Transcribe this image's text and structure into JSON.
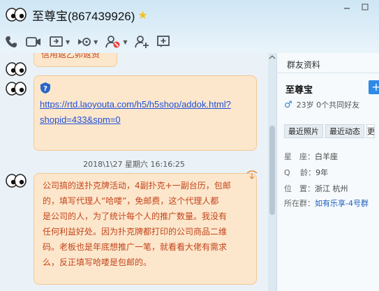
{
  "window": {
    "title": "至尊宝(867439926)"
  },
  "toolbar": {
    "items": [
      {
        "icon": "phone-icon"
      },
      {
        "icon": "video-camera-icon"
      },
      {
        "icon": "screen-share-icon"
      },
      {
        "icon": "remote-assist-icon"
      },
      {
        "icon": "block-user-icon"
      },
      {
        "icon": "add-user-icon"
      },
      {
        "icon": "new-window-icon"
      }
    ]
  },
  "chat": {
    "top_bubble_text": "信用返乙卯返资",
    "link_line1": "https://rtd.laoyouta.com/h5/h5shop/addok.html?",
    "link_line2": "shopid=433&spm=0",
    "timestamp": "2018\\1\\27 星期六 16:16:25",
    "message_lines": [
      "公司搞的送扑克牌活动，4副扑克+一副台历，包邮",
      "的，填写代理人“哈喽”，免邮费，这个代理人都",
      "是公司的人，为了统计每个人的推广数量。我没有",
      "任何利益好处。因为扑克牌都打印的公司商品二维",
      "码。老板也是年底想推广一笔，就看看大佬有需求",
      "么，反正填写哈喽是包邮的。"
    ]
  },
  "panel": {
    "title": "群友资料",
    "name": "至尊宝",
    "add_label": "+",
    "meta": "23岁 0个共同好友",
    "tabs": [
      "最近照片",
      "最近动态",
      "更"
    ],
    "zodiac_label": "星　座：",
    "zodiac_value": "白羊座",
    "age_label": "Q　 龄：",
    "age_value": "9年",
    "location_label": "位　置：",
    "location_value": "浙江 杭州",
    "group_label": "所在群：",
    "group_value": "如有乐享-4号群"
  },
  "colors": {
    "bubble_bg": "#fde7cc",
    "bubble_text": "#c2451c",
    "link": "#1f4fd8",
    "accent": "#2e8ae6"
  }
}
